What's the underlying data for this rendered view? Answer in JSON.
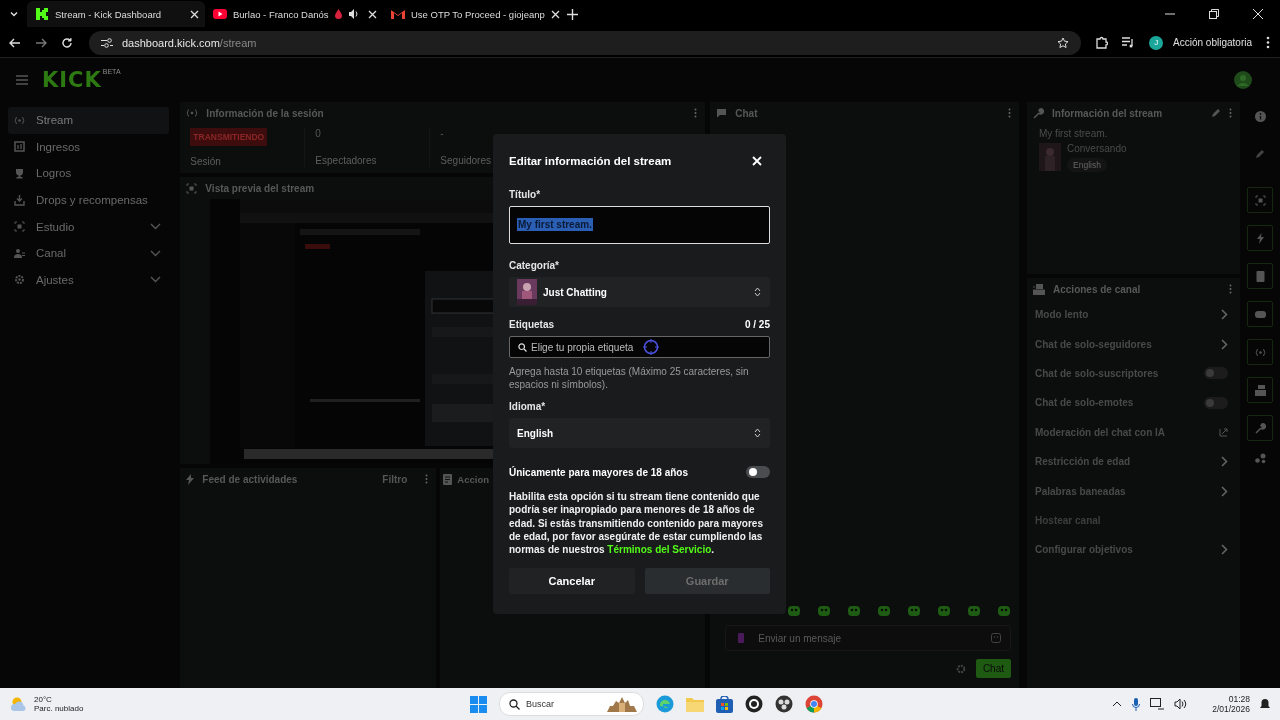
{
  "browser": {
    "tabs": [
      {
        "title": "Stream - Kick Dashboard",
        "kind": "kick",
        "selected": true,
        "audio": false
      },
      {
        "title": "Burlao - Franco Danós",
        "kind": "video",
        "selected": false,
        "audio": true
      },
      {
        "title": "Use OTP To Proceed - giojeanp",
        "kind": "mail",
        "selected": false,
        "audio": false
      }
    ],
    "url_host": "dashboard.kick.com",
    "url_path": "/stream",
    "profile_initial": "J",
    "action": "Acción obligatoria"
  },
  "header": {
    "logo": "KICK",
    "logo_badge": "BETA"
  },
  "sidebar": [
    {
      "label": "Stream",
      "kind": "stream",
      "selected": true,
      "expandable": false
    },
    {
      "label": "Ingresos",
      "kind": "money",
      "selected": false,
      "expandable": false
    },
    {
      "label": "Logros",
      "kind": "trophy",
      "selected": false,
      "expandable": false
    },
    {
      "label": "Drops y recompensas",
      "kind": "drops",
      "selected": false,
      "expandable": false
    },
    {
      "label": "Estudio",
      "kind": "studio",
      "selected": false,
      "expandable": true
    },
    {
      "label": "Canal",
      "kind": "channel",
      "selected": false,
      "expandable": true
    },
    {
      "label": "Ajustes",
      "kind": "settings",
      "selected": false,
      "expandable": true
    }
  ],
  "session": {
    "title": "Información de la sesión",
    "status": "TRANSMITIENDO",
    "status_label": "Sesión",
    "stats": [
      {
        "value": "0",
        "label": "Espectadores"
      },
      {
        "value": "-",
        "label": "Seguidores"
      }
    ]
  },
  "preview": {
    "title": "Vista previa del stream"
  },
  "feed": {
    "title": "Feed de actividades",
    "filter": "Filtro"
  },
  "actions_panel": {
    "title": "Accion"
  },
  "chat": {
    "title": "Chat",
    "placeholder": "Enviar un mensaje",
    "send": "Chat"
  },
  "stream_info": {
    "title": "Información del stream",
    "stream_title": "My first stream.",
    "category": "Conversando",
    "language": "English"
  },
  "channel_actions": {
    "title": "Acciones de canal",
    "items": [
      {
        "label": "Modo lento",
        "kind": "link"
      },
      {
        "label": "Chat de solo-seguidores",
        "kind": "link"
      },
      {
        "label": "Chat de solo-suscriptores",
        "kind": "toggle",
        "on": false
      },
      {
        "label": "Chat de solo-emotes",
        "kind": "toggle",
        "on": false
      },
      {
        "label": "Moderación del chat con IA",
        "kind": "external"
      },
      {
        "label": "Restricción de edad",
        "kind": "link"
      },
      {
        "label": "Palabras baneadas",
        "kind": "link"
      },
      {
        "label": "Hostear canal",
        "kind": "disabled"
      },
      {
        "label": "Configurar objetivos",
        "kind": "link"
      }
    ]
  },
  "modal": {
    "title": "Editar información del stream",
    "title_label": "Título*",
    "title_value": "My first stream.",
    "title_selected": true,
    "category_label": "Categoría*",
    "category": "Just Chatting",
    "tags_label": "Etiquetas",
    "tags_count": "0 / 25",
    "tags_placeholder": "Elige tu propia etiqueta",
    "tags_hint": "Agrega hasta 10 etiquetas (Máximo 25 caracteres, sin espacios ni símbolos).",
    "language_label": "Idioma*",
    "language": "English",
    "adult_label": "Únicamente para mayores de 18 años",
    "adult_on": false,
    "adult_text": "Habilita esta opción si tu stream tiene contenido que podría ser inapropiado para menores de 18 años de edad. Si estás transmitiendo contenido para mayores de edad, por favor asegúrate de estar cumpliendo las normas de nuestros ",
    "terms_link": "Términos del Servicio",
    "terms_end": ".",
    "cancel": "Cancelar",
    "save": "Guardar",
    "save_disabled": true
  },
  "taskbar": {
    "temperature": "20°C",
    "weather": "Parc. nublado",
    "search": "Buscar",
    "time": "01:28",
    "date": "2/01/2026"
  }
}
